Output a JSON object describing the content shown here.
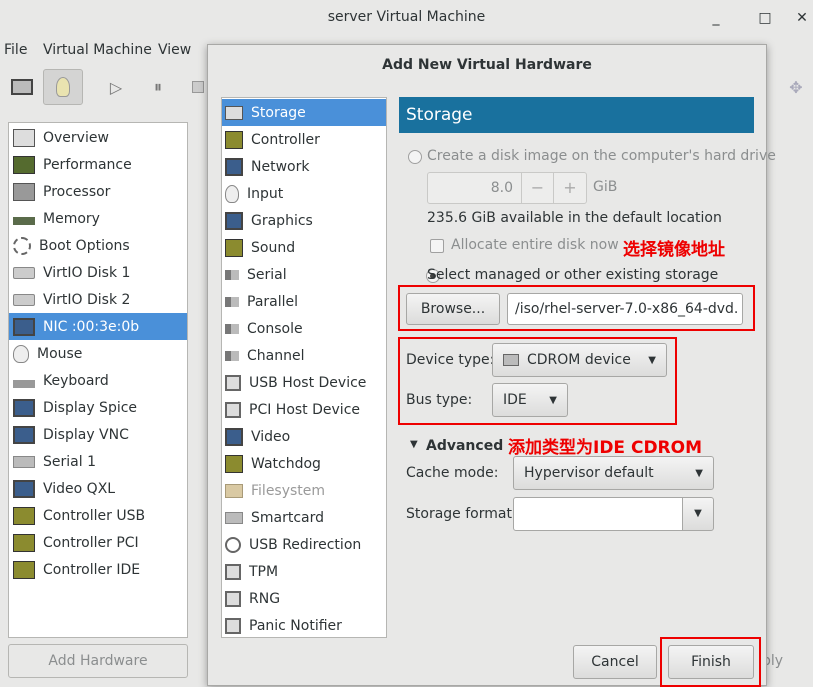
{
  "window": {
    "title": "server Virtual Machine",
    "controls": {
      "minimize": "_",
      "maximize": "□",
      "close": "✕"
    }
  },
  "menubar": [
    "File",
    "Virtual Machine",
    "View"
  ],
  "sidebar": {
    "items": [
      {
        "label": "Overview",
        "icon": "overview-icon"
      },
      {
        "label": "Performance",
        "icon": "performance-icon"
      },
      {
        "label": "Processor",
        "icon": "processor-icon"
      },
      {
        "label": "Memory",
        "icon": "memory-icon"
      },
      {
        "label": "Boot Options",
        "icon": "gear-icon"
      },
      {
        "label": "VirtIO Disk 1",
        "icon": "disk-icon"
      },
      {
        "label": "VirtIO Disk 2",
        "icon": "disk-icon"
      },
      {
        "label": "NIC :00:3e:0b",
        "icon": "network-icon",
        "selected": true
      },
      {
        "label": "Mouse",
        "icon": "mouse-icon"
      },
      {
        "label": "Keyboard",
        "icon": "keyboard-icon"
      },
      {
        "label": "Display Spice",
        "icon": "display-icon"
      },
      {
        "label": "Display VNC",
        "icon": "display-icon"
      },
      {
        "label": "Serial 1",
        "icon": "serial-icon"
      },
      {
        "label": "Video QXL",
        "icon": "video-icon"
      },
      {
        "label": "Controller USB",
        "icon": "controller-icon"
      },
      {
        "label": "Controller PCI",
        "icon": "controller-icon"
      },
      {
        "label": "Controller IDE",
        "icon": "controller-icon"
      }
    ],
    "add_hardware": "Add Hardware",
    "apply_partial": "ply"
  },
  "dialog": {
    "title": "Add New Virtual Hardware",
    "hardware_list": [
      {
        "label": "Storage",
        "icon": "storage-icon",
        "selected": true
      },
      {
        "label": "Controller",
        "icon": "controller-icon"
      },
      {
        "label": "Network",
        "icon": "network-icon"
      },
      {
        "label": "Input",
        "icon": "mouse-icon"
      },
      {
        "label": "Graphics",
        "icon": "display-icon"
      },
      {
        "label": "Sound",
        "icon": "sound-icon"
      },
      {
        "label": "Serial",
        "icon": "plug-icon"
      },
      {
        "label": "Parallel",
        "icon": "plug-icon"
      },
      {
        "label": "Console",
        "icon": "plug-icon"
      },
      {
        "label": "Channel",
        "icon": "plug-icon"
      },
      {
        "label": "USB Host Device",
        "icon": "chip-icon"
      },
      {
        "label": "PCI Host Device",
        "icon": "chip-icon"
      },
      {
        "label": "Video",
        "icon": "display-icon"
      },
      {
        "label": "Watchdog",
        "icon": "watchdog-icon"
      },
      {
        "label": "Filesystem",
        "icon": "folder-icon",
        "disabled": true
      },
      {
        "label": "Smartcard",
        "icon": "smartcard-icon"
      },
      {
        "label": "USB Redirection",
        "icon": "usb-icon"
      },
      {
        "label": "TPM",
        "icon": "chip-icon"
      },
      {
        "label": "RNG",
        "icon": "chip-icon"
      },
      {
        "label": "Panic Notifier",
        "icon": "chip-icon"
      }
    ],
    "storage": {
      "header": "Storage",
      "create_disk_label": "Create a disk image on the computer's hard drive",
      "size_value": "8.0",
      "size_minus": "−",
      "size_plus": "+",
      "size_unit": "GiB",
      "available": "235.6 GiB available in the default location",
      "allocate_label": "Allocate entire disk now",
      "managed_label": "Select managed or other existing storage",
      "browse_label": "Browse...",
      "path_value": "/iso/rhel-server-7.0-x86_64-dvd.",
      "device_type_label": "Device type:",
      "device_type_value": "CDROM device",
      "bus_type_label": "Bus type:",
      "bus_type_value": "IDE",
      "advanced_label": "Advanced options",
      "cache_mode_label": "Cache mode:",
      "cache_mode_value": "Hypervisor default",
      "storage_format_label": "Storage format:",
      "storage_format_value": ""
    },
    "cancel_label": "Cancel",
    "finish_label": "Finish"
  },
  "annotations": {
    "select_image": "选择镜像地址",
    "add_type": "添加类型为IDE  CDROM"
  },
  "colors": {
    "accent": "#4a90d9",
    "header": "#19719e",
    "annotation": "#ee0000"
  }
}
